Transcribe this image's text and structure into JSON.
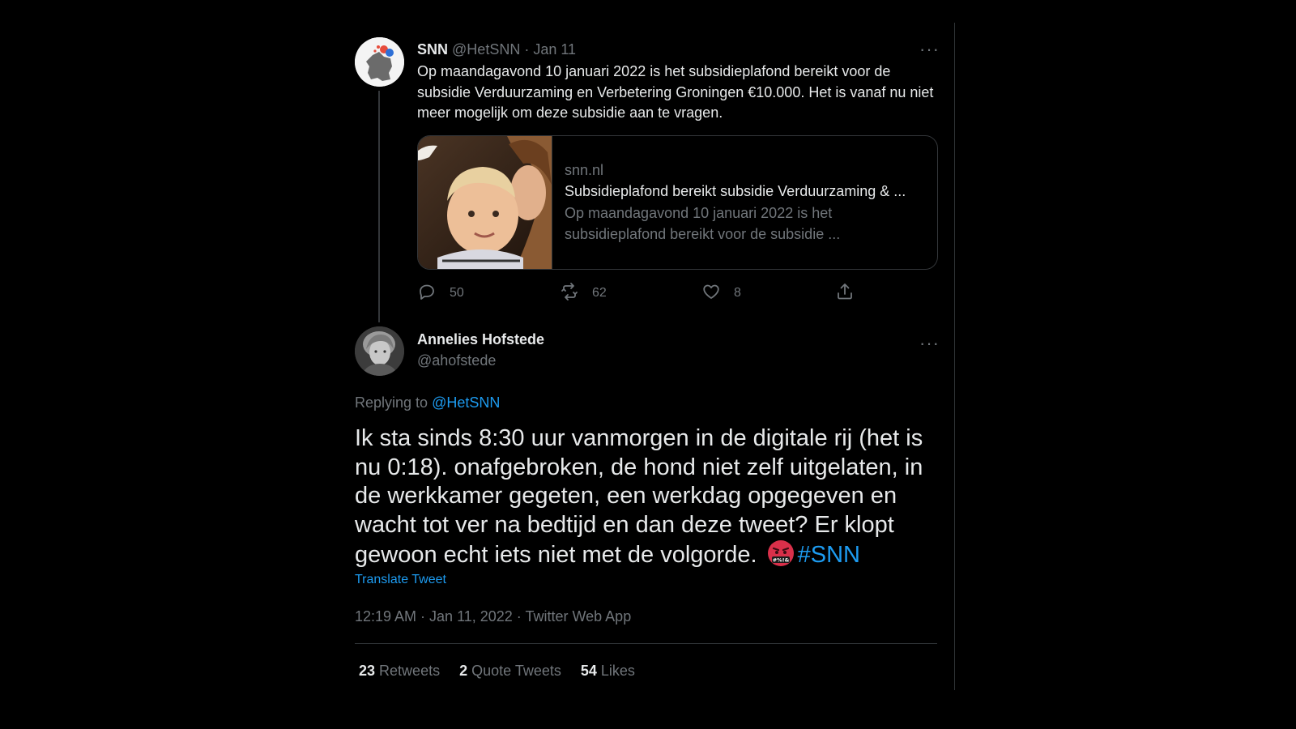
{
  "parent_tweet": {
    "name": "SNN",
    "handle": "@HetSNN",
    "separator": "·",
    "date": "Jan 11",
    "more": "···",
    "text": "Op maandagavond 10 januari 2022 is het subsidieplafond bereikt voor de subsidie Verduurzaming en Verbetering Groningen €10.000. Het is vanaf nu niet meer mogelijk om deze subsidie aan te vragen.",
    "card": {
      "domain": "snn.nl",
      "title": "Subsidieplafond bereikt subsidie Verduurzaming & ...",
      "description_line1": "Op maandagavond 10 januari 2022 is het",
      "description_line2": "subsidieplafond bereikt voor de subsidie ..."
    },
    "actions": {
      "replies": "50",
      "retweets": "62",
      "likes": "8"
    },
    "icons": [
      "reply-icon",
      "retweet-icon",
      "like-icon",
      "share-icon"
    ]
  },
  "reply_tweet": {
    "name": "Annelies Hofstede",
    "handle": "@ahofstede",
    "more": "···",
    "replying_prefix": "Replying to",
    "replying_handle": "@HetSNN",
    "text": "Ik sta sinds 8:30 uur vanmorgen in de digitale rij (het is nu 0:18). onafgebroken, de hond niet zelf uitgelaten, in de werkkamer gegeten, een werkdag opgegeven en wacht tot ver na bedtijd en dan deze tweet? Er klopt gewoon echt iets niet met de volgorde.",
    "emoji": "face-with-symbols-on-mouth",
    "emoji_symbols": "#%!&",
    "hashtag": "#SNN",
    "translate": "Translate Tweet",
    "meta": "12:19 AM · Jan 11, 2022 · Twitter Web App",
    "stats": {
      "retweets_count": "23",
      "retweets_label": "Retweets",
      "quotes_count": "2",
      "quotes_label": "Quote Tweets",
      "likes_count": "54",
      "likes_label": "Likes"
    }
  },
  "colors": {
    "background": "#000000",
    "text": "#e7e9ea",
    "muted": "#71767b",
    "link": "#1d9bf0",
    "border": "#2f3336"
  }
}
